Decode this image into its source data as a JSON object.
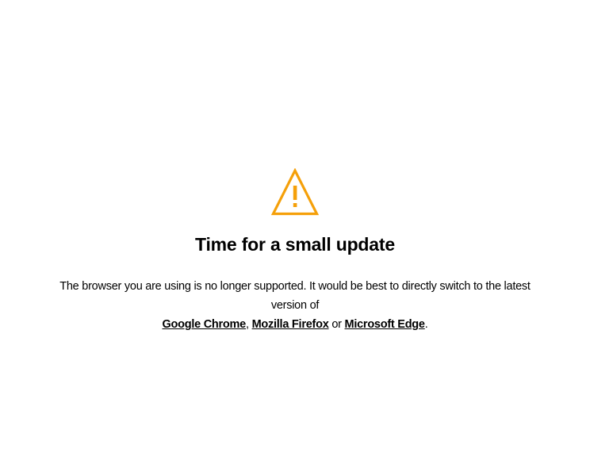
{
  "icon": "warning-triangle-icon",
  "accent_color": "#f5a00a",
  "title": "Time for a small update",
  "message": {
    "text": "The browser you are using is no longer supported. It would be best to directly switch to the latest version of",
    "browsers": [
      {
        "label": "Google Chrome"
      },
      {
        "label": "Mozilla Firefox"
      },
      {
        "label": "Microsoft Edge"
      }
    ],
    "separator_comma": ",",
    "separator_or": "or",
    "end": "."
  }
}
